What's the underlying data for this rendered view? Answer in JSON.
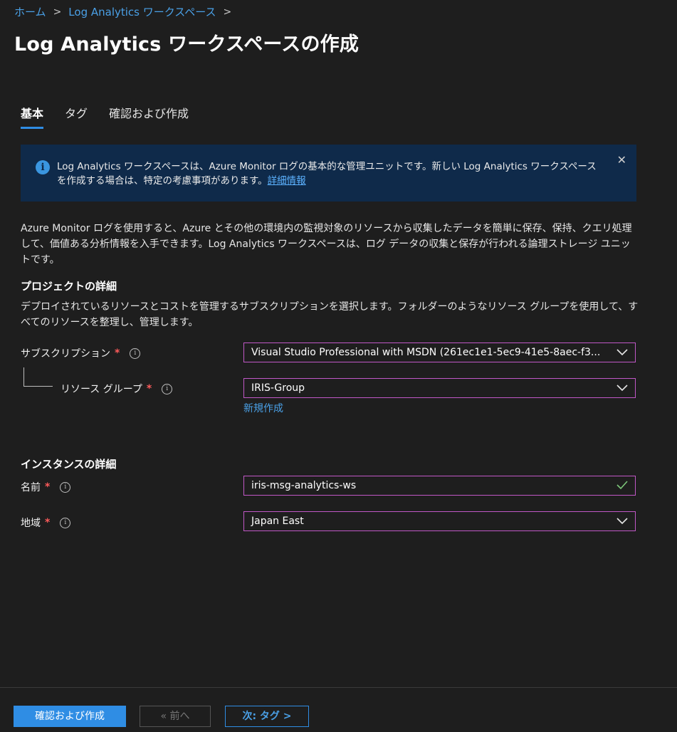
{
  "breadcrumb": {
    "home": "ホーム",
    "workspaces": "Log Analytics ワークスペース"
  },
  "page": {
    "title": "Log Analytics ワークスペースの作成",
    "more": "..."
  },
  "tabs": [
    {
      "label": "基本"
    },
    {
      "label": "タグ"
    },
    {
      "label": "確認および作成"
    }
  ],
  "banner": {
    "text": "Log Analytics ワークスペースは、Azure Monitor ログの基本的な管理ユニットです。新しい Log Analytics ワークスペースを作成する場合は、特定の考慮事項があります。",
    "link": "詳細情報",
    "close": "✕",
    "icon_glyph": "i"
  },
  "description": "Azure Monitor ログを使用すると、Azure とその他の環境内の監視対象のリソースから収集したデータを簡単に保存、保持、クエリ処理して、価値ある分析情報を入手できます。Log Analytics ワークスペースは、ログ データの収集と保存が行われる論理ストレージ ユニットです。",
  "project": {
    "heading": "プロジェクトの詳細",
    "description": "デプロイされているリソースとコストを管理するサブスクリプションを選択します。フォルダーのようなリソース グループを使用して、すべてのリソースを整理し、管理します。",
    "subscription": {
      "label": "サブスクリプション",
      "value": "Visual Studio Professional with MSDN (261ec1e1-5ec9-41e5-8aec-f3..."
    },
    "resource_group": {
      "label": "リソース グループ",
      "value": "IRIS-Group",
      "new_link": "新規作成"
    }
  },
  "instance": {
    "heading": "インスタンスの詳細",
    "name": {
      "label": "名前",
      "value": "iris-msg-analytics-ws"
    },
    "region": {
      "label": "地域",
      "value": "Japan East"
    }
  },
  "required_mark": "*",
  "info_glyph": "i",
  "footer": {
    "review_create": "確認および作成",
    "previous": "« 前へ",
    "next": "次: タグ >"
  },
  "colors": {
    "accent": "#2f8de4",
    "banner_bg": "#0f2a4a",
    "field_border": "#c158c7",
    "required": "#ff5b5b",
    "valid_check": "#7dc77a"
  }
}
